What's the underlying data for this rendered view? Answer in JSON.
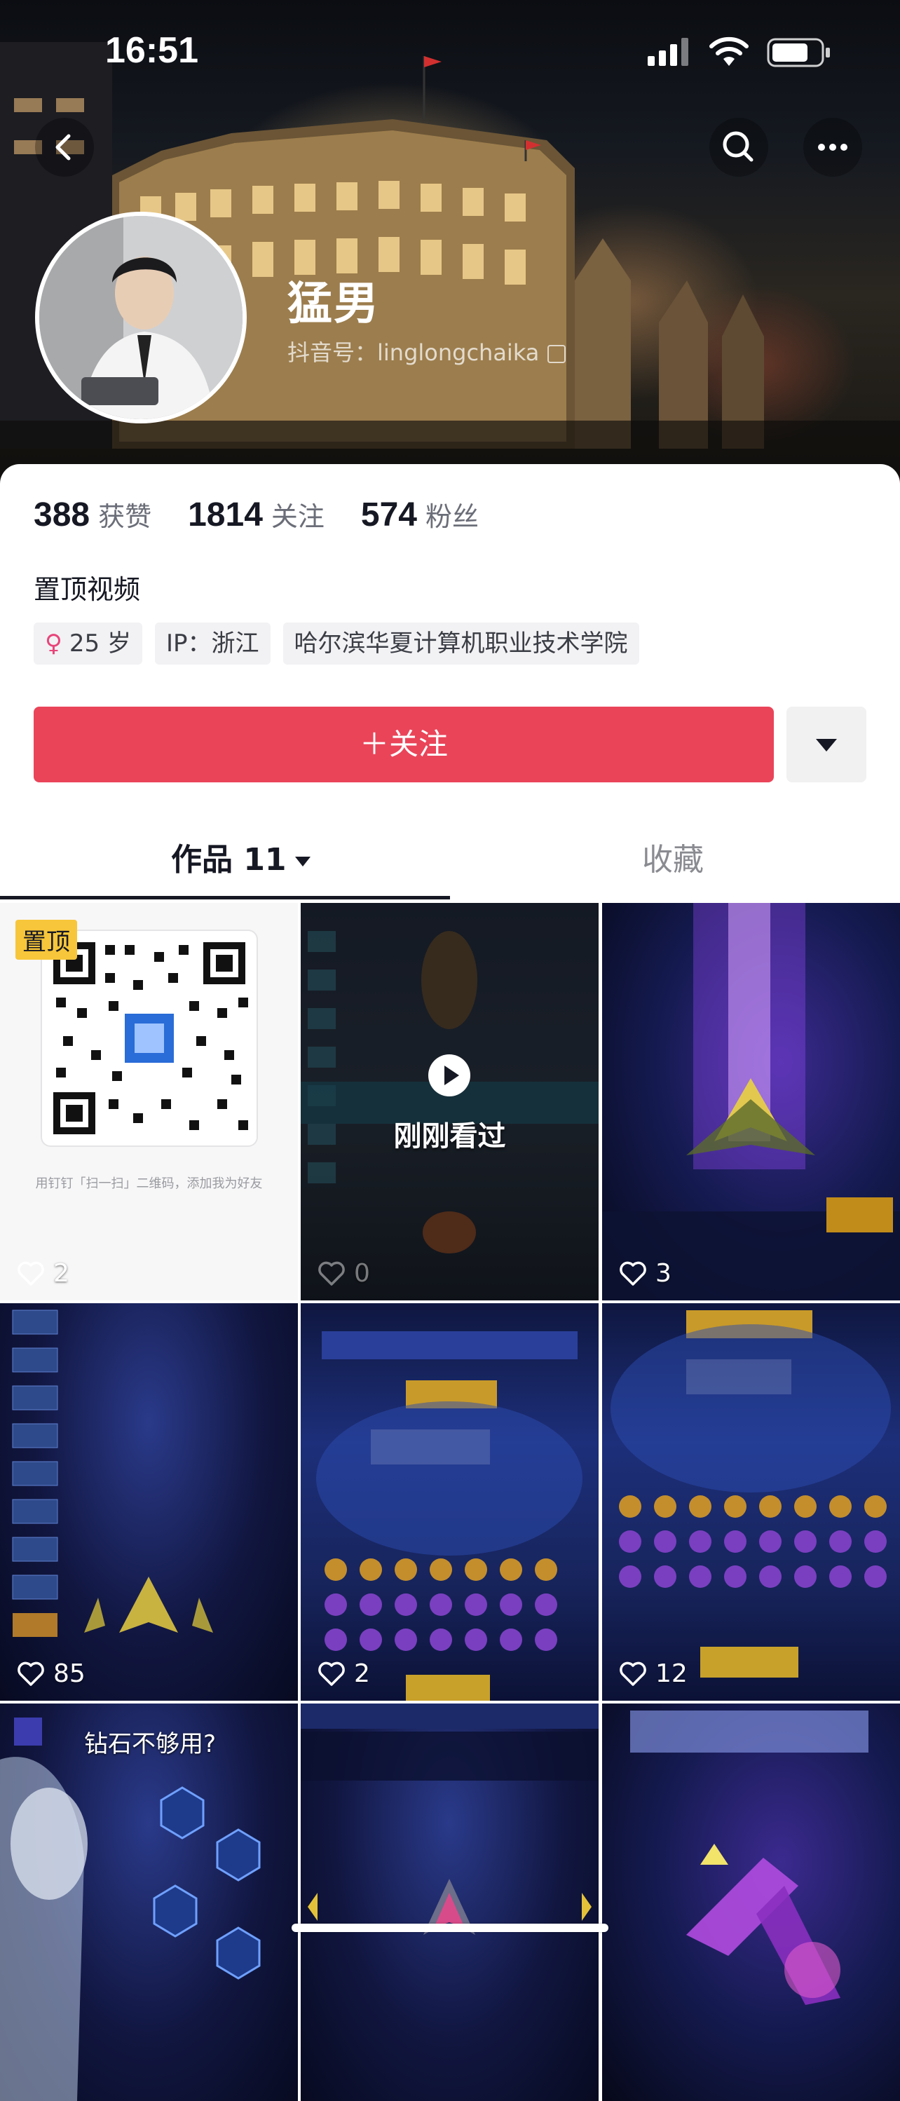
{
  "status_bar": {
    "time": "16:51"
  },
  "header": {
    "back_icon": "chevron-left-icon",
    "search_icon": "search-icon",
    "more_icon": "ellipsis-icon"
  },
  "profile": {
    "name": "猛男",
    "douyin_id": "抖音号：linglongchaika",
    "stats": [
      {
        "value": "388",
        "label": "获赞"
      },
      {
        "value": "1814",
        "label": "关注"
      },
      {
        "value": "574",
        "label": "粉丝"
      }
    ],
    "pinned_section": "置顶视频",
    "tags": [
      {
        "icon": "♀",
        "text": "25 岁"
      },
      {
        "text": "IP：浙江"
      },
      {
        "text": "哈尔滨华夏计算机职业技术学院"
      }
    ],
    "follow_label": "＋关注"
  },
  "tabs": {
    "works": "作品 11",
    "favorites": "收藏"
  },
  "grid": [
    {
      "pinned_badge": "置顶",
      "caption": "用钉钉「扫一扫」二维码，添加我为好友",
      "likes": "2"
    },
    {
      "overlay": "刚刚看过",
      "likes": "0"
    },
    {
      "likes": "3"
    },
    {
      "likes": "85"
    },
    {
      "likes": "2"
    },
    {
      "likes": "12"
    },
    {
      "caption": "钻石不够用?"
    },
    {},
    {}
  ],
  "colors": {
    "accent": "#ea4459",
    "pin_badge": "#f7c63a"
  }
}
